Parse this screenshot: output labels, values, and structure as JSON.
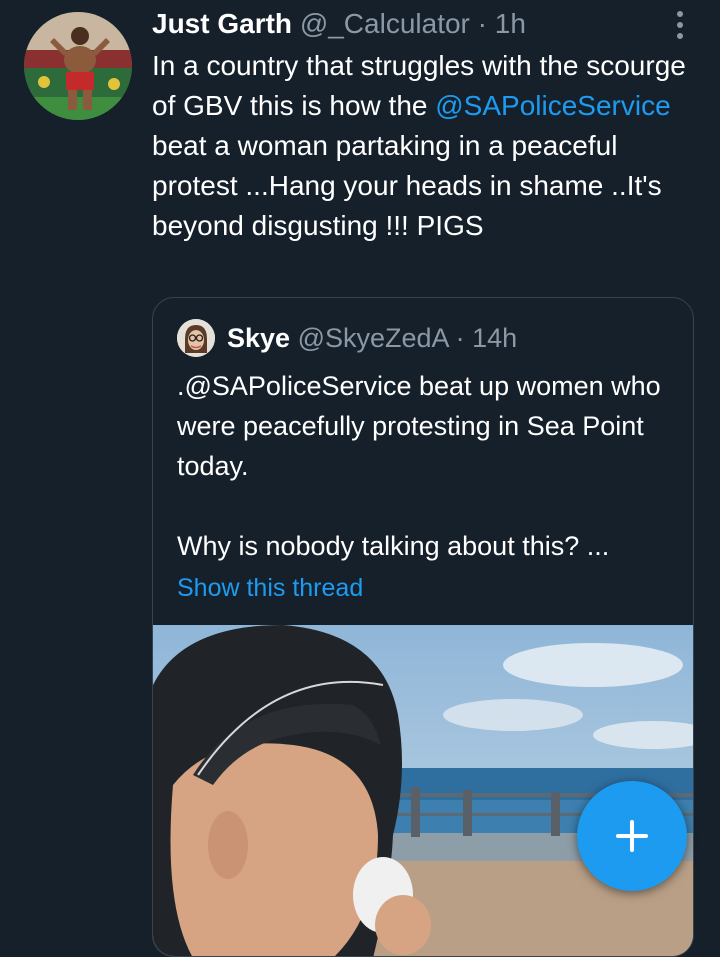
{
  "tweet": {
    "author_name": "Just Garth",
    "author_handle": "@_Calculator",
    "separator": " · ",
    "time": "1h",
    "text_part1": "In a country that struggles with the scourge of GBV this is how the ",
    "mention": "@SAPoliceService",
    "text_part2": " beat a woman partaking in a peaceful protest ...Hang your heads in shame ..It's beyond disgusting !!! PIGS"
  },
  "quoted": {
    "author_name": "Skye",
    "author_handle": "@SkyeZedA",
    "separator": " · ",
    "time": "14h",
    "paragraph1": ".@SAPoliceService beat up women who were peacefully protesting in Sea Point today.",
    "paragraph2": "Why is nobody talking about this? ...",
    "show_thread": "Show this thread"
  },
  "icons": {
    "more": "more-vertical-icon",
    "compose": "plus-icon"
  },
  "colors": {
    "background": "#15202b",
    "accent": "#1d9bf0",
    "secondary_text": "#8b98a5",
    "border": "#38444d"
  }
}
